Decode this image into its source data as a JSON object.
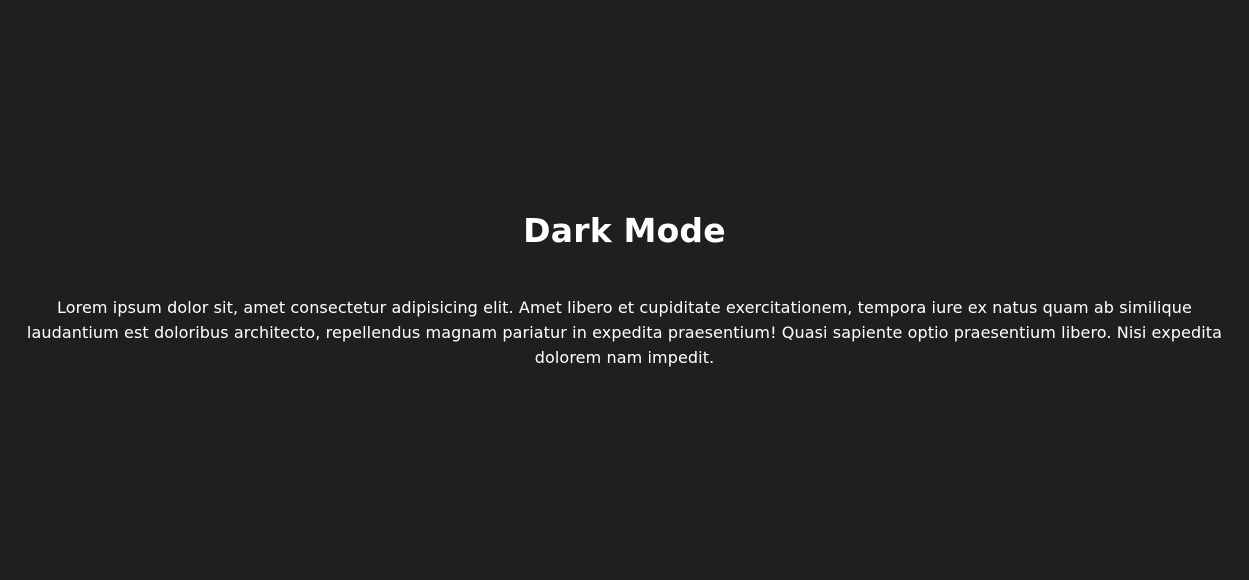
{
  "theme": {
    "background": "#1f1f1f",
    "text": "#ffffff"
  },
  "main": {
    "title": "Dark Mode",
    "paragraph": "Lorem ipsum dolor sit, amet consectetur adipisicing elit. Amet libero et cupiditate exercitationem, tempora iure ex natus quam ab similique laudantium est doloribus architecto, repellendus magnam pariatur in expedita praesentium! Quasi sapiente optio praesentium libero. Nisi expedita dolorem nam impedit."
  }
}
